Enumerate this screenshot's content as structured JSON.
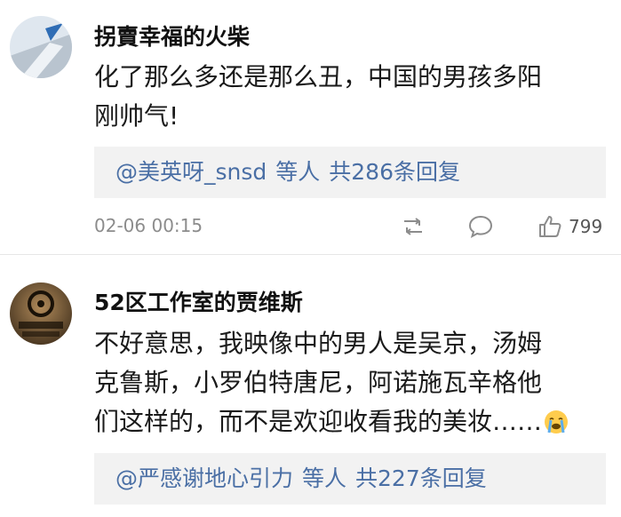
{
  "comments": [
    {
      "username": "拐賣幸福的火柴",
      "lines": [
        "化了那么多还是那么丑，中国的男孩多阳",
        "刚帅气!"
      ],
      "reply_summary": {
        "mention": "@美英呀_snsd",
        "suffix": "等人",
        "count_text": "共286条回复"
      },
      "timestamp": "02-06 00:15",
      "like_count": "799"
    },
    {
      "username": "52区工作室的贾维斯",
      "lines": [
        "不好意思，我映像中的男人是吴京，汤姆",
        "克鲁斯，小罗伯特唐尼，阿诺施瓦辛格他",
        "们这样的，而不是欢迎收看我的美妆……"
      ],
      "reply_summary": {
        "mention": "@严感谢地心引力",
        "suffix": "等人",
        "count_text": "共227条回复"
      }
    }
  ],
  "icons": {
    "repost": "repost-icon",
    "comment": "comment-icon",
    "like": "thumbs-up-icon",
    "emoji": "crying-face-emoji"
  },
  "colors": {
    "mention": "#4a6fa5",
    "reply_box": "#f2f2f2",
    "meta_text": "#8c8c8c"
  }
}
